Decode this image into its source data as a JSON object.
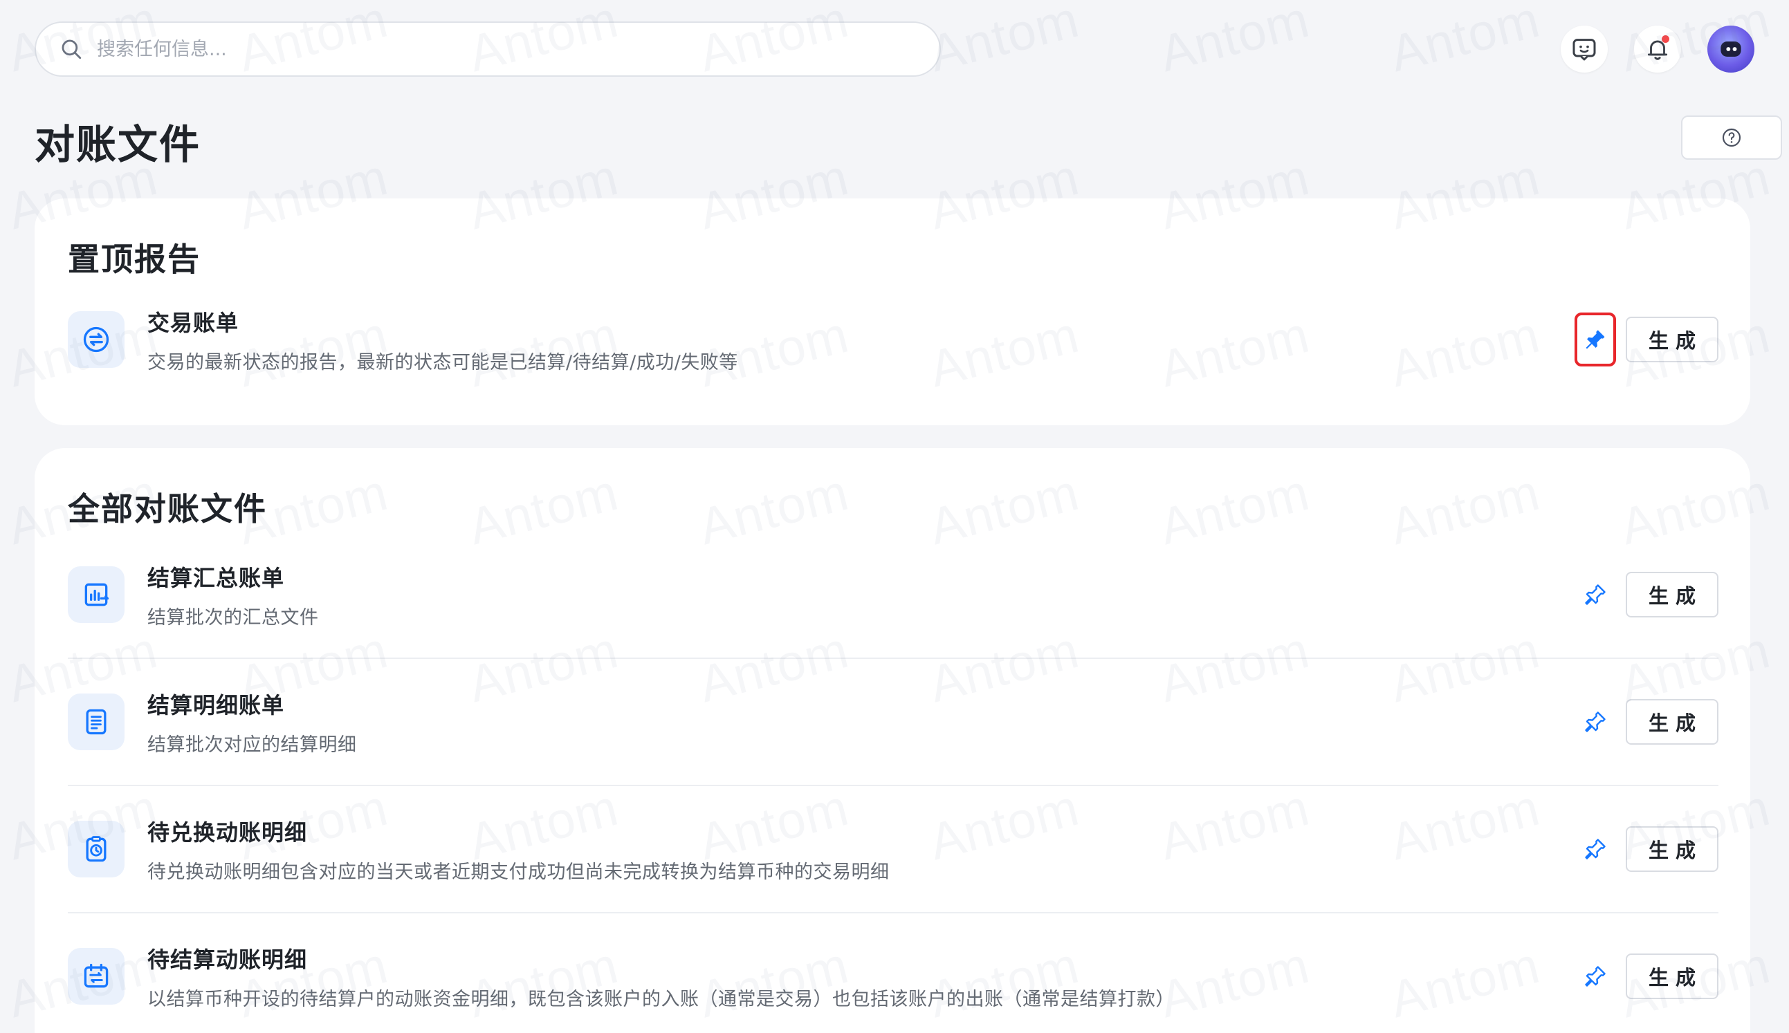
{
  "search": {
    "placeholder": "搜索任何信息..."
  },
  "header": {
    "title": "对账文件"
  },
  "watermark": {
    "text": "Antom"
  },
  "pinned": {
    "title": "置顶报告",
    "items": [
      {
        "title": "交易账单",
        "desc": "交易的最新状态的报告，最新的状态可能是已结算/待结算/成功/失败等",
        "icon": "exchange-icon",
        "pinned": true,
        "button": "生成"
      }
    ]
  },
  "all": {
    "title": "全部对账文件",
    "items": [
      {
        "title": "结算汇总账单",
        "desc": "结算批次的汇总文件",
        "icon": "chart-report-icon",
        "pinned": false,
        "button": "生成"
      },
      {
        "title": "结算明细账单",
        "desc": "结算批次对应的结算明细",
        "icon": "list-document-icon",
        "pinned": false,
        "button": "生成"
      },
      {
        "title": "待兑换动账明细",
        "desc": "待兑换动账明细包含对应的当天或者近期支付成功但尚未完成转换为结算币种的交易明细",
        "icon": "clipboard-clock-icon",
        "pinned": false,
        "button": "生成"
      },
      {
        "title": "待结算动账明细",
        "desc": "以结算币种开设的待结算户的动账资金明细，既包含该账户的入账（通常是交易）也包括该账户的出账（通常是结算打款）",
        "icon": "calendar-exchange-icon",
        "pinned": false,
        "button": "生成"
      }
    ]
  },
  "colors": {
    "accent": "#1677ff",
    "highlight": "#e8262b"
  }
}
